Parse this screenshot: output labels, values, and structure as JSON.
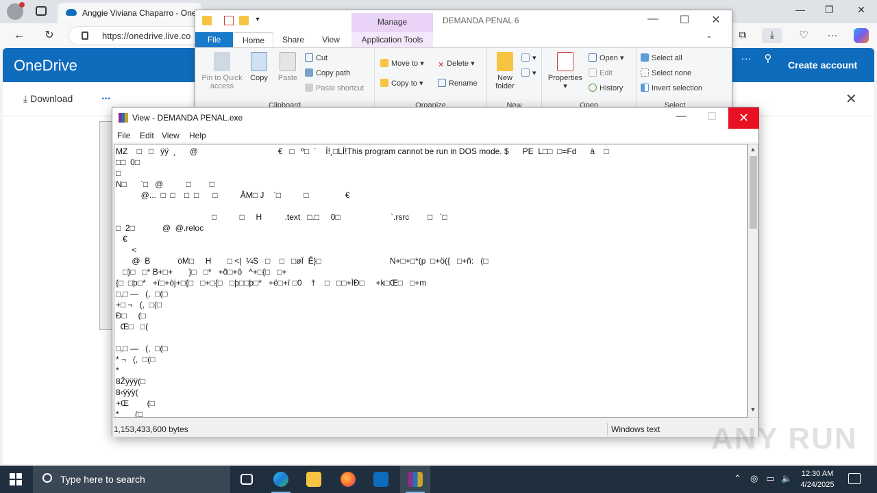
{
  "browser": {
    "tab_title": "Anggie Viviana Chaparro - OneD",
    "url": "https://onedrive.live.co"
  },
  "onedrive": {
    "brand": "OneDrive",
    "create_account": "Create account",
    "download_label": "Download",
    "more_label": "...",
    "accent_color": "#0f6cbd"
  },
  "explorer": {
    "window_title": "DEMANDA PENAL 6",
    "context_header": "Manage",
    "tabs": {
      "file": "File",
      "home": "Home",
      "share": "Share",
      "view": "View",
      "app_tools": "Application Tools"
    },
    "clipboard": {
      "pin": "Pin to Quick access",
      "copy": "Copy",
      "paste": "Paste",
      "cut": "Cut",
      "copy_path": "Copy path",
      "paste_shortcut": "Paste shortcut",
      "group": "Clipboard"
    },
    "organize": {
      "move_to": "Move to",
      "copy_to": "Copy to",
      "delete": "Delete",
      "rename": "Rename",
      "group": "Organize"
    },
    "new": {
      "new_folder": "New folder",
      "group": "New"
    },
    "open": {
      "properties": "Properties",
      "open": "Open",
      "edit": "Edit",
      "history": "History",
      "group": "Open"
    },
    "select": {
      "select_all": "Select all",
      "select_none": "Select none",
      "invert": "Invert selection",
      "group": "Select"
    }
  },
  "viewer": {
    "title": "View - DEMANDA PENAL.exe",
    "menu": [
      "File",
      "Edit",
      "View",
      "Help"
    ],
    "lines": [
      "MZ    □   □   ÿÿ  ¸      @                                   €   □   º□  ´    Í!¸□LÍ!This program cannot be run in DOS mode. $      PE  L□□  □=Fd      à    □",
      "□□  0□",
      "□",
      "N□      `□   @          □        □",
      "           @...  □  □    □  □      □          ÂM□ J    `□          □                €",
      "",
      "                                          □          □     H          .text   □.□     0□                      `.rsrc        □   `□",
      "□  2□            @  @.reloc",
      "   €",
      "       <",
      "       @  B            òM□     H       □ <|  ¼S   □    □   □øÏ  Ê}□                              N+□+□*(p  □+ö({   □+ñ:   (□",
      "   □}□   □* B+□+       }□   □*   +õ□+ô   ^+□{□   □+",
      "{□  □þ□*   +ï□+òj+□{□   □+□{□   □þ□□þ□*   +ë□+ï □0    †    □   □□+ÌÐ□     +k□Œ□   □+m",
      "□,□ —   (,  □(□",
      "+□ ¬   (,  □(□",
      "Ð□     (□",
      "  Œ□   □(",
      "",
      "□,□ —   (,  □(□",
      "* ¬   (,  □(□",
      "*",
      "8Žÿÿÿ(□",
      "8‹ÿÿÿ(",
      "+Œ        (□",
      "*       (□"
    ],
    "status_size": "1,153,433,600 bytes",
    "status_encoding": "Windows text"
  },
  "watermark": "ANY RUN",
  "taskbar": {
    "search_placeholder": "Type here to search",
    "time": "12:30 AM",
    "date": "4/24/2025"
  }
}
